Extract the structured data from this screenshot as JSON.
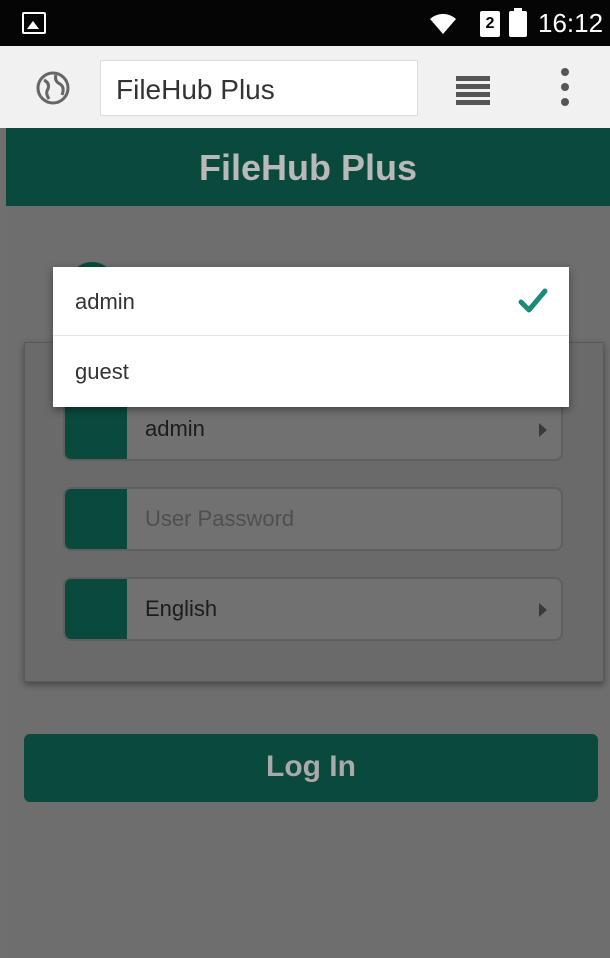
{
  "status_bar": {
    "time": "16:12",
    "sim_label": "2",
    "icons": [
      "image-icon",
      "wifi-icon",
      "sim-icon",
      "battery-icon"
    ]
  },
  "browser_toolbar": {
    "address_text": "FileHub Plus",
    "icons": [
      "globe-icon",
      "menu-lines-icon",
      "overflow-menu-icon"
    ]
  },
  "app": {
    "title": "FileHub Plus",
    "accent_color": "#0a4a3d"
  },
  "login_form": {
    "user_select_value": "admin",
    "password_placeholder": "User Password",
    "language_select_value": "English",
    "login_button_label": "Log In"
  },
  "user_dropdown": {
    "options": [
      {
        "label": "admin",
        "selected": true
      },
      {
        "label": "guest",
        "selected": false
      }
    ],
    "check_color": "#1a8a7a"
  }
}
